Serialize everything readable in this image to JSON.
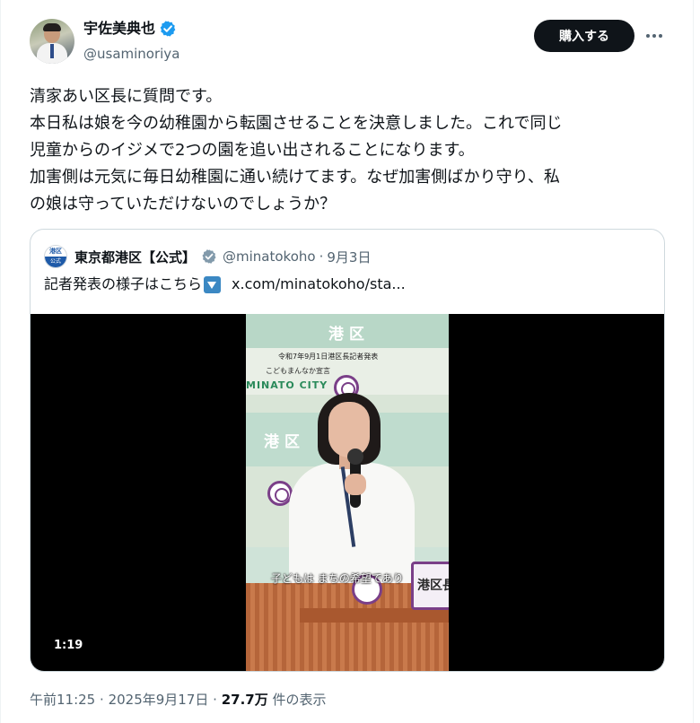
{
  "author": {
    "display_name": "宇佐美典也",
    "handle": "@usaminoriya",
    "verified_icon": "verified-badge-blue",
    "avatar_icon": "user-avatar"
  },
  "actions": {
    "subscribe_label": "購入する",
    "more_icon": "more-horizontal"
  },
  "tweet": {
    "lines": [
      "清家あい区長に質問です。",
      "本日私は娘を今の幼稚園から転園させることを決意しました。これで同じ",
      "児童からのイジメで2つの園を追い出されることになります。",
      "加害側は元気に毎日幼稚園に通い続けてます。なぜ加害側ばかり守り、私",
      "の娘は守っていただけないのでしょうか？"
    ]
  },
  "quote": {
    "logo_top": "港区",
    "logo_bottom": "公式",
    "name": "東京都港区【公式】",
    "badge_icon": "government-verified-badge-gray",
    "handle": "@minatokoho",
    "separator": "·",
    "date": "9月3日",
    "text_before": "記者発表の様子はこちら",
    "arrow_icon": "down-arrow-emoji",
    "link": "x.com/minatokoho/sta...",
    "video": {
      "sign_top": "港区",
      "banner_line1": "令和7年9月1日港区長記者発表",
      "banner_line2": "こどもまんなか宣言",
      "city_label": "MINATO CITY",
      "sign_middle": "港区",
      "plate_text": "港区長",
      "subtitle": "子どもは まちの希望であり",
      "duration": "1:19"
    }
  },
  "meta": {
    "time": "午前11:25",
    "dot1": "·",
    "date": "2025年9月17日",
    "dot2": "·",
    "views": "27.7万",
    "views_suffix": "件の表示"
  },
  "colors": {
    "text_primary": "#0f1419",
    "text_secondary": "#536471",
    "verified_blue": "#1d9bf0",
    "button_bg": "#0f1419",
    "border": "#cfd9de"
  }
}
